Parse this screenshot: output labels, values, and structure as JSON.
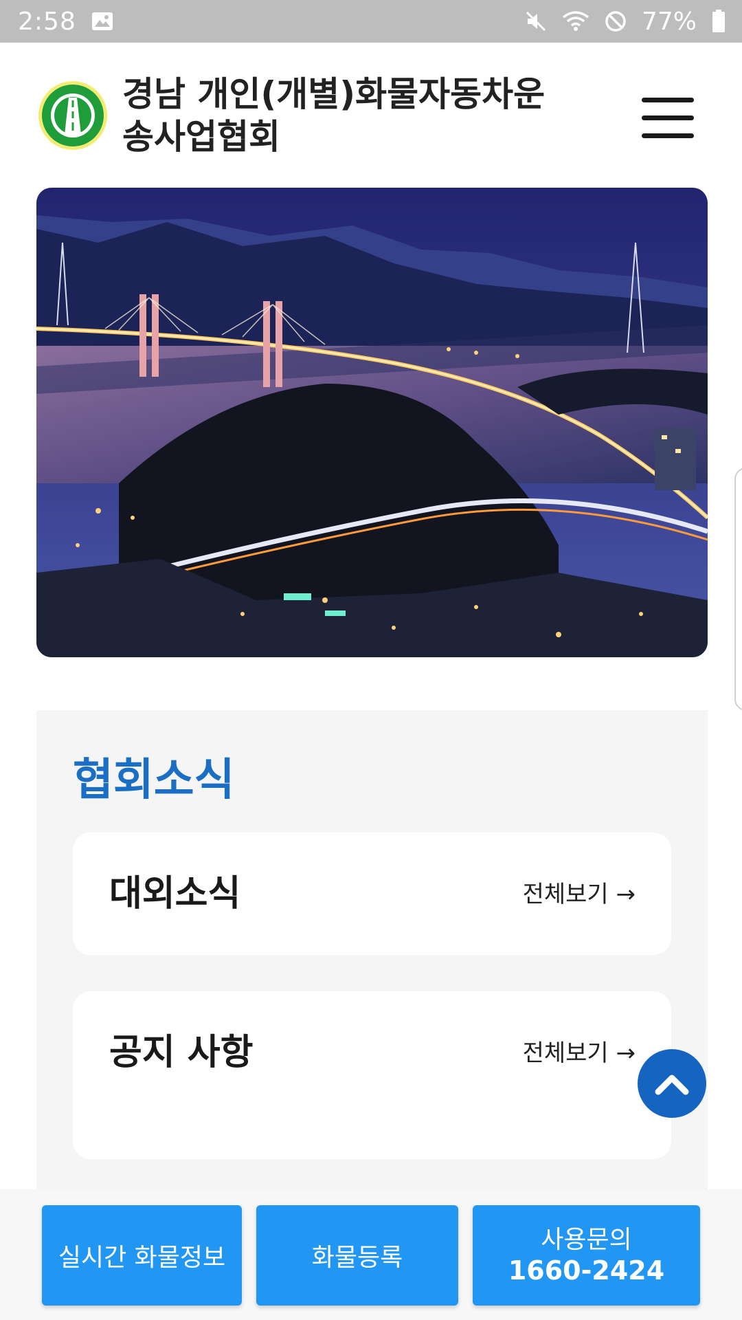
{
  "status_bar": {
    "time": "2:58",
    "battery": "77%",
    "icons": [
      "image-icon",
      "mute-icon",
      "wifi-icon",
      "do-not-disturb-icon",
      "battery-icon"
    ]
  },
  "header": {
    "title": "경남 개인(개별)화물자동차운송사업협회",
    "logo_icon": "association-logo",
    "menu_icon": "hamburger-menu-icon"
  },
  "hero": {
    "image": "night-bridge-landscape"
  },
  "news": {
    "heading": "협회소식",
    "cards": [
      {
        "title": "대외소식",
        "view_all": "전체보기 →"
      },
      {
        "title": "공지 사항",
        "view_all": "전체보기 →"
      }
    ]
  },
  "bottom_bar": {
    "realtime": "실시간 화물정보",
    "register": "화물등록",
    "contact_label": "사용문의",
    "contact_phone": "1660-2424"
  },
  "colors": {
    "accent": "#1a6fc4",
    "button": "#2196f3",
    "scroll_top": "#1565c0",
    "status_bar": "#bdbdbd"
  }
}
